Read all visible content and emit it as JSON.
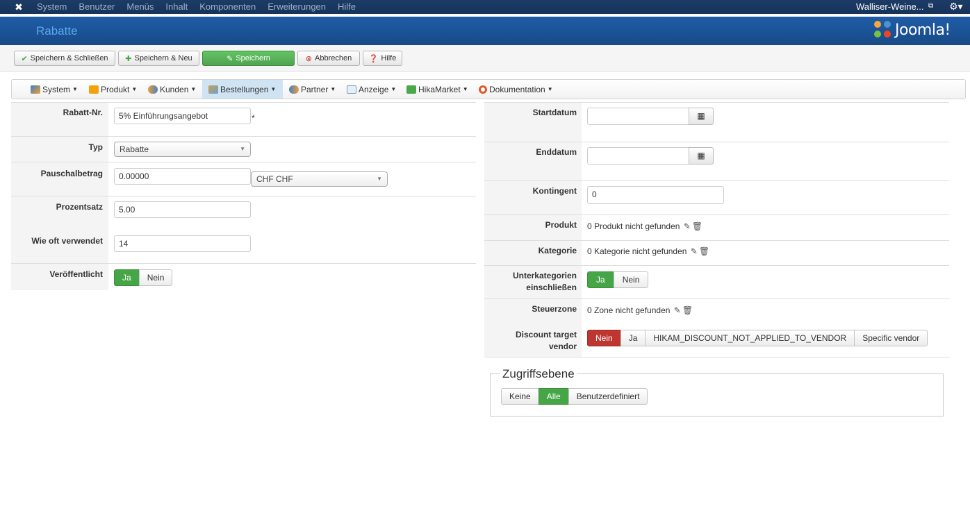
{
  "topbar": {
    "menu": [
      "System",
      "Benutzer",
      "Menüs",
      "Inhalt",
      "Komponenten",
      "Erweiterungen",
      "Hilfe"
    ],
    "site_name": "Walliser-Weine...",
    "icons": {
      "logo": "joomla-icon",
      "external": "external-link-icon",
      "settings": "gear-icon"
    }
  },
  "header": {
    "title": "Rabatte",
    "brand": "Joomla!"
  },
  "toolbar": {
    "save_close": "Speichern & Schließen",
    "save_new": "Speichern & Neu",
    "save": "Speichern",
    "cancel": "Abbrechen",
    "help": "Hilfe"
  },
  "hikamenu": [
    {
      "label": "System",
      "icon": "wrench-icon"
    },
    {
      "label": "Produkt",
      "icon": "box-icon"
    },
    {
      "label": "Kunden",
      "icon": "users-icon"
    },
    {
      "label": "Bestellungen",
      "icon": "orders-icon"
    },
    {
      "label": "Partner",
      "icon": "partner-icon"
    },
    {
      "label": "Anzeige",
      "icon": "display-icon"
    },
    {
      "label": "HikaMarket",
      "icon": "hikamarket-icon"
    },
    {
      "label": "Dokumentation",
      "icon": "lifebuoy-icon"
    }
  ],
  "form_left": {
    "code_label": "Rabatt-Nr.",
    "code_value": "5% Einführungsangebot",
    "required_mark": "*",
    "type_label": "Typ",
    "type_value": "Rabatte",
    "flat_label": "Pauschalbetrag",
    "flat_value": "0.00000",
    "currency_value": "CHF CHF",
    "percent_label": "Prozentsatz",
    "percent_value": "5.00",
    "used_label": "Wie oft verwendet",
    "used_value": "14",
    "published_label": "Veröffentlicht",
    "yes": "Ja",
    "no": "Nein"
  },
  "form_right": {
    "start_label": "Startdatum",
    "start_value": "",
    "end_label": "Enddatum",
    "end_value": "",
    "quota_label": "Kontingent",
    "quota_value": "0",
    "product_label": "Produkt",
    "product_value": "0 Produkt nicht gefunden",
    "category_label": "Kategorie",
    "category_value": "0 Kategorie nicht gefunden",
    "subcat_label_1": "Unterkategorien",
    "subcat_label_2": "einschließen",
    "zone_label": "Steuerzone",
    "zone_value": "0 Zone nicht gefunden",
    "target_label_1": "Discount target",
    "target_label_2": "vendor",
    "target_options": [
      "Nein",
      "Ja",
      "HIKAM_DISCOUNT_NOT_APPLIED_TO_VENDOR",
      "Specific vendor"
    ],
    "yes": "Ja",
    "no": "Nein"
  },
  "access": {
    "legend": "Zugriffsebene",
    "options": [
      "Keine",
      "Alle",
      "Benutzerdefiniert"
    ]
  },
  "colors": {
    "accent_green": "#46a546",
    "danger_red": "#bd362f",
    "header_blue": "#1f5da7"
  }
}
